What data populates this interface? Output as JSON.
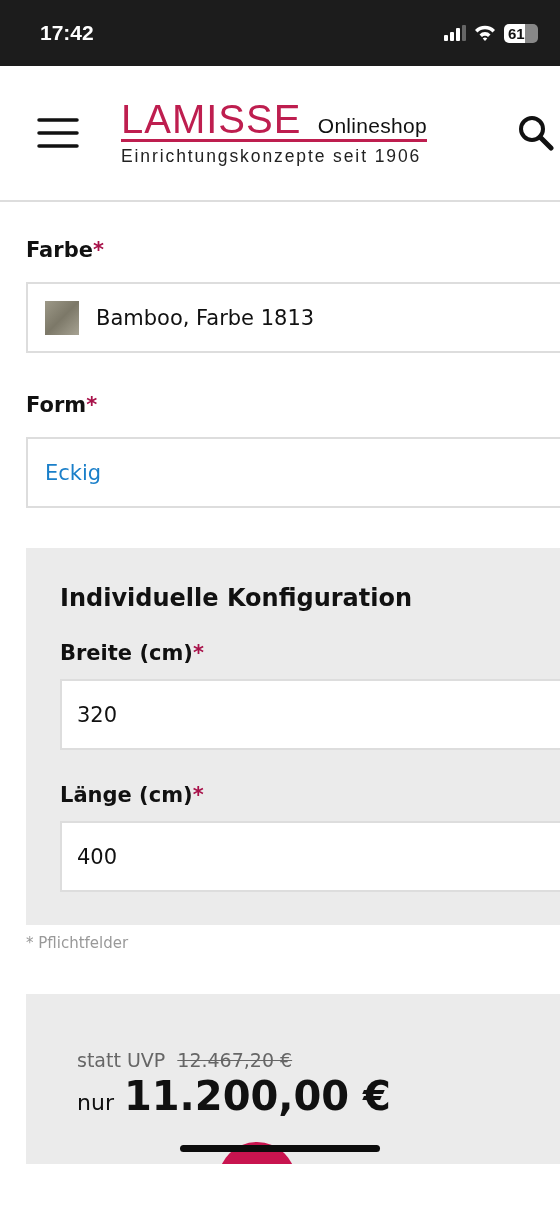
{
  "status_bar": {
    "time": "17:42",
    "battery": "61"
  },
  "header": {
    "brand": "LAMISSE",
    "brand_suffix": "Onlineshop",
    "tagline": "Einrichtungskonzepte seit 1906"
  },
  "options": [
    {
      "kind": "swatch",
      "label": "Farbe",
      "required_mark": "*",
      "value": "Bamboo, Farbe 1813"
    },
    {
      "kind": "link",
      "label": "Form",
      "required_mark": "*",
      "value": "Eckig"
    }
  ],
  "configuration": {
    "title": "Individuelle Konfiguration",
    "fields": [
      {
        "label": "Breite (cm)",
        "required_mark": "*",
        "value": "320"
      },
      {
        "label": "Länge (cm)",
        "required_mark": "*",
        "value": "400"
      }
    ]
  },
  "required_note": "* Pflichtfelder",
  "price": {
    "old_prefix": "statt UVP",
    "old_price": "12.467,20 €",
    "prefix": "nur",
    "price": "11.200,00 €"
  }
}
